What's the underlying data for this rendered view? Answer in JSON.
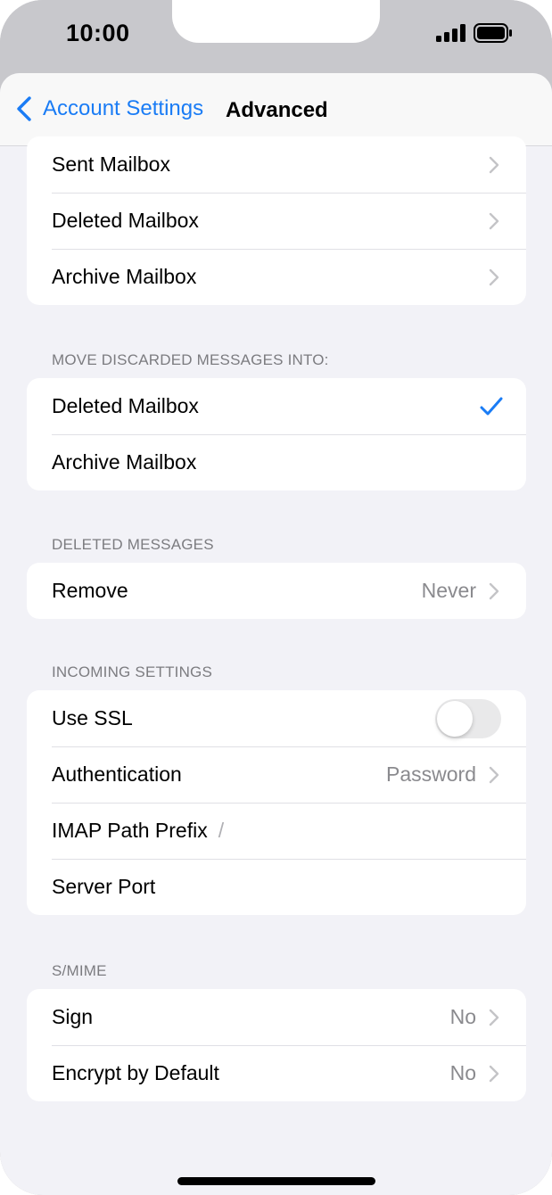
{
  "status": {
    "time": "10:00"
  },
  "nav": {
    "back_label": "Account Settings",
    "title": "Advanced"
  },
  "mailboxes": {
    "items": [
      {
        "label": "Sent Mailbox"
      },
      {
        "label": "Deleted Mailbox"
      },
      {
        "label": "Archive Mailbox"
      }
    ]
  },
  "discard": {
    "header": "MOVE DISCARDED MESSAGES INTO:",
    "items": [
      {
        "label": "Deleted Mailbox",
        "selected": true
      },
      {
        "label": "Archive Mailbox",
        "selected": false
      }
    ]
  },
  "deleted": {
    "header": "DELETED MESSAGES",
    "remove_label": "Remove",
    "remove_value": "Never"
  },
  "incoming": {
    "header": "INCOMING SETTINGS",
    "use_ssl_label": "Use SSL",
    "use_ssl_on": false,
    "auth_label": "Authentication",
    "auth_value": "Password",
    "imap_label": "IMAP Path Prefix",
    "imap_value": "/",
    "port_label": "Server Port"
  },
  "smime": {
    "header": "S/MIME",
    "sign_label": "Sign",
    "sign_value": "No",
    "encrypt_label": "Encrypt by Default",
    "encrypt_value": "No"
  },
  "colors": {
    "accent": "#1a7cf5",
    "background": "#f2f2f7",
    "secondary_text": "#8a8a8e"
  }
}
